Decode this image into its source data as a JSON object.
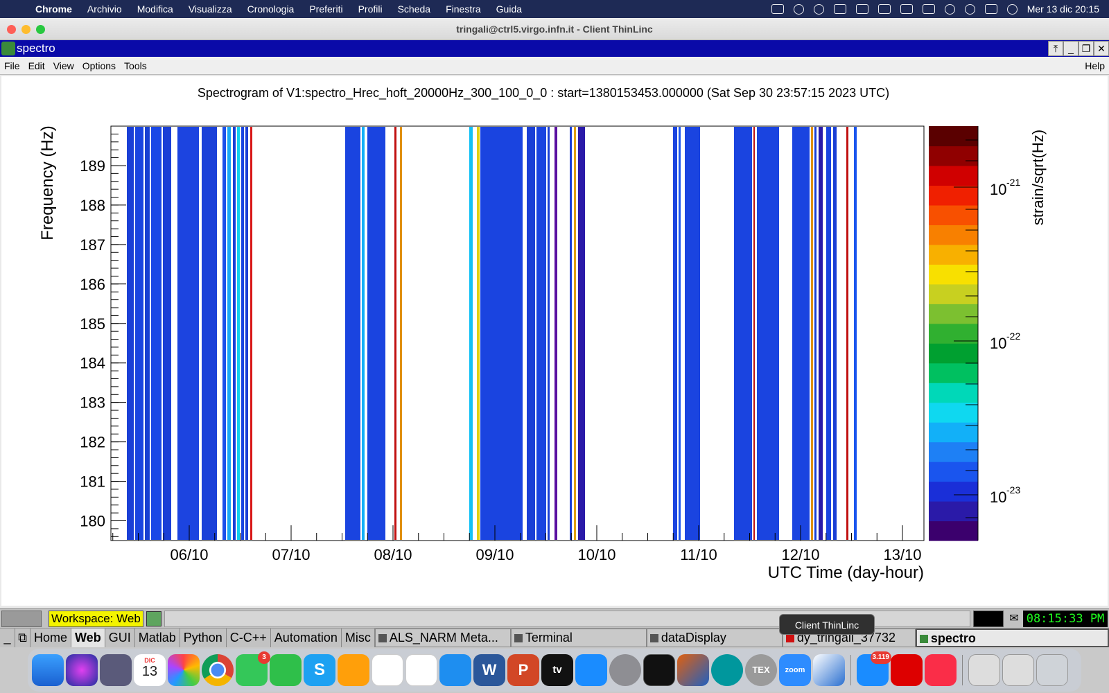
{
  "menubar": {
    "app": "Chrome",
    "items": [
      "Archivio",
      "Modifica",
      "Visualizza",
      "Cronologia",
      "Preferiti",
      "Profili",
      "Scheda",
      "Finestra",
      "Guida"
    ],
    "clock": "Mer 13 dic  20:15"
  },
  "window": {
    "title": "tringali@ctrl5.virgo.infn.it - Client ThinLinc"
  },
  "xwindow": {
    "title": "spectro",
    "menus": [
      "File",
      "Edit",
      "View",
      "Options",
      "Tools"
    ],
    "help": "Help"
  },
  "chart_data": {
    "type": "heatmap",
    "title": "Spectrogram of V1:spectro_Hrec_hoft_20000Hz_300_100_0_0 : start=1380153453.000000 (Sat Sep 30 23:57:15 2023 UTC)",
    "xlabel": "UTC Time (day-hour)",
    "ylabel": "Frequency (Hz)",
    "x_ticks": [
      "06/10",
      "07/10",
      "08/10",
      "09/10",
      "10/10",
      "11/10",
      "12/10",
      "13/10"
    ],
    "y_ticks": [
      180,
      181,
      182,
      183,
      184,
      185,
      186,
      187,
      188,
      189
    ],
    "ylim": [
      179.5,
      190
    ],
    "colorbar": {
      "label": "strain/sqrt(Hz)",
      "ticks": [
        {
          "base": "10",
          "exp": "-21"
        },
        {
          "base": "10",
          "exp": "-22"
        },
        {
          "base": "10",
          "exp": "-23"
        }
      ],
      "colors": [
        "#3b006d",
        "#2a1aa8",
        "#1a2fd8",
        "#1a55ee",
        "#1e80f5",
        "#12b0f8",
        "#0fd8f0",
        "#00d8b8",
        "#00c060",
        "#00a030",
        "#30b030",
        "#7cc030",
        "#c8d020",
        "#f8e000",
        "#f8b000",
        "#f88000",
        "#f85000",
        "#f02000",
        "#d00000",
        "#900000",
        "#5a0000"
      ]
    }
  },
  "panel": {
    "workspace": "Workspace: Web",
    "digital_clock": "08:15:33 PM",
    "pages": [
      "Home",
      "Web",
      "GUI",
      "Matlab",
      "Python",
      "C-C++",
      "Automation",
      "Misc"
    ],
    "tasks": [
      "ALS_NARM Meta...",
      "Terminal",
      "dataDisplay",
      "dy_tringali_37732",
      "spectro"
    ]
  },
  "tooltip": "Client ThinLinc",
  "dock": {
    "calendar": {
      "month": "DIC",
      "day": "13"
    },
    "messages_badge": "3",
    "mail_badge": "3.119",
    "labels": {
      "tv": "tv",
      "tex": "TEX",
      "zoom": "zoom",
      "skype": "S",
      "word": "W",
      "ppt": "P"
    }
  }
}
